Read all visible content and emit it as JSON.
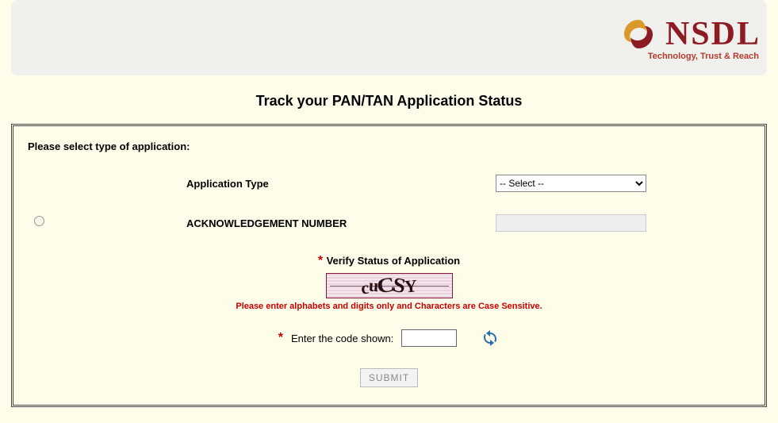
{
  "header": {
    "brand": "NSDL",
    "tagline": "Technology, Trust & Reach"
  },
  "title": "Track your PAN/TAN Application Status",
  "form": {
    "instruction": "Please select type of application:",
    "app_type_label": "Application Type",
    "app_type_selected": "-- Select --",
    "ack_label": "ACKNOWLEDGEMENT NUMBER",
    "ack_value": ""
  },
  "captcha": {
    "verify_label": "Verify Status of Application",
    "code_text": "cuCSY",
    "note": "Please enter alphabets and digits only and Characters are Case Sensitive.",
    "enter_label": "Enter the code shown:",
    "input_value": ""
  },
  "submit_label": "SUBMIT"
}
